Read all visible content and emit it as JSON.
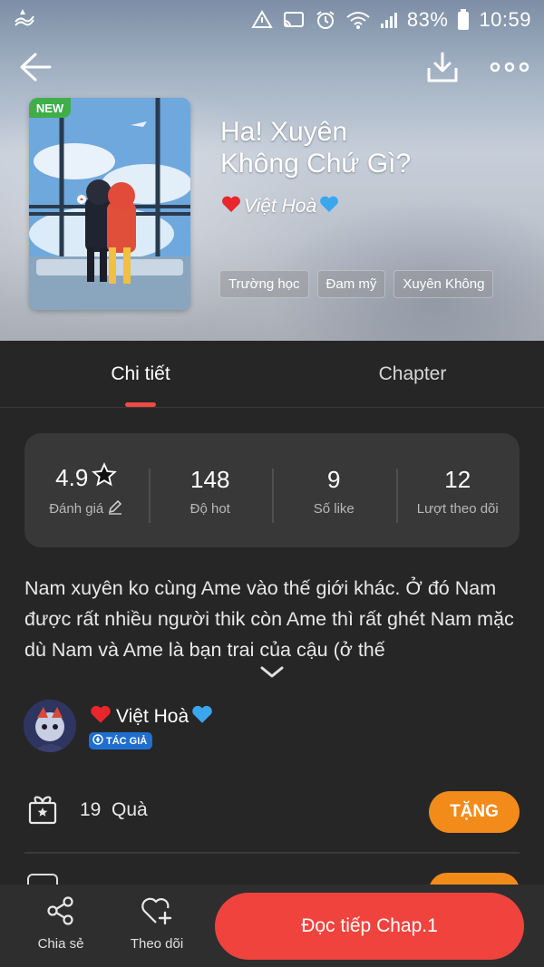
{
  "status_bar": {
    "battery": "83%",
    "time": "10:59"
  },
  "story": {
    "badge": "NEW",
    "title_line1": "Ha! Xuyên",
    "title_line2": "Không Chứ Gì?",
    "author": "Việt Hoà",
    "tags": [
      "Trường học",
      "Đam mỹ",
      "Xuyên Không"
    ]
  },
  "tabs": {
    "detail": "Chi tiết",
    "chapter": "Chapter",
    "active": "detail"
  },
  "stats": [
    {
      "value": "4.9",
      "label": "Đánh giá"
    },
    {
      "value": "148",
      "label": "Độ hot"
    },
    {
      "value": "9",
      "label": "Số like"
    },
    {
      "value": "12",
      "label": "Lượt theo dõi"
    }
  ],
  "description": "Nam xuyên ko cùng Ame vào thế giới khác. Ở đó Nam được rất nhiều người thik còn Ame thì rất ghét Nam mặc dù Nam và Ame là bạn trai của cậu (ở thế",
  "author_section": {
    "name": "Việt Hoà",
    "role_badge": "TÁC GIẢ"
  },
  "gifts": {
    "count": "19",
    "label": "Quà",
    "button": "TẶNG"
  },
  "bottom_bar": {
    "share": "Chia sẻ",
    "follow": "Theo dõi",
    "read": "Đọc tiếp Chap.1"
  },
  "colors": {
    "accent_red": "#f0433e",
    "gift_orange": "#f28b1a",
    "new_green": "#3fae49",
    "author_blue": "#1f6fd1",
    "background": "#262626"
  },
  "icons": {
    "back": "arrow-left-icon",
    "download": "download-icon",
    "more": "more-horizontal-icon",
    "star": "star-icon",
    "edit": "pencil-icon",
    "expand": "chevron-down-icon",
    "gift": "gift-icon",
    "share": "share-icon",
    "follow": "heart-plus-icon"
  }
}
